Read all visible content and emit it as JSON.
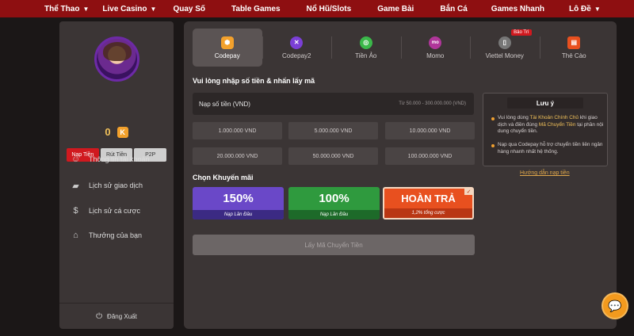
{
  "nav": {
    "items": [
      {
        "label": "Thể Thao",
        "chevron": true
      },
      {
        "label": "Live Casino",
        "chevron": true
      },
      {
        "label": "Quay Số",
        "chevron": false
      },
      {
        "label": "Table Games",
        "chevron": false
      },
      {
        "label": "Nổ Hũ/Slots",
        "chevron": false
      },
      {
        "label": "Game Bài",
        "chevron": false
      },
      {
        "label": "Bắn Cá",
        "chevron": false
      },
      {
        "label": "Games Nhanh",
        "chevron": false
      },
      {
        "label": "Lô Đề",
        "chevron": true
      }
    ]
  },
  "account": {
    "balance": "0",
    "currency": "K",
    "tabs": [
      "Nạp Tiền",
      "Rút Tiền",
      "P2P"
    ],
    "active_tab": "Nạp Tiền",
    "menu": [
      {
        "label": "Thông tin tài khoản",
        "icon": "user-icon"
      },
      {
        "label": "Lịch sử giao dịch",
        "icon": "wallet-icon"
      },
      {
        "label": "Lịch sử cá cược",
        "icon": "money-bag-icon"
      },
      {
        "label": "Thưởng của bạn",
        "icon": "gift-icon"
      }
    ],
    "logout": "Đăng Xuất"
  },
  "payment": {
    "methods": [
      {
        "label": "Codepay",
        "icon": "codepay-icon",
        "color": "#f3a12c",
        "glyph": "⬢"
      },
      {
        "label": "Codepay2",
        "icon": "codepay2-icon",
        "color": "#7b3fd6",
        "glyph": "✕"
      },
      {
        "label": "Tiền Ảo",
        "icon": "crypto-icon",
        "color": "#3bb84a",
        "glyph": "◎"
      },
      {
        "label": "Momo",
        "icon": "momo-icon",
        "color": "#b0369a",
        "glyph": "mo"
      },
      {
        "label": "Viettel Money",
        "icon": "viettel-money-icon",
        "color": "#777777",
        "glyph": "▯",
        "badge": "Bảo Trì"
      },
      {
        "label": "Thẻ Cào",
        "icon": "scratch-card-icon",
        "color": "#e8501f",
        "glyph": "▤"
      }
    ],
    "active_method": "Codepay",
    "instruction": "Vui lòng nhập số tiền & nhấn lấy mã",
    "amount_label": "Nạp số tiền (VND)",
    "amount_range": "Từ 50.000 - 300.000.000 (VND)",
    "presets": [
      "1.000.000 VND",
      "5.000.000 VND",
      "10.000.000 VND",
      "20.000.000 VND",
      "50.000.000 VND",
      "100.000.000 VND"
    ],
    "promo_heading": "Chọn Khuyến mãi",
    "promos": [
      {
        "title": "150%",
        "subtitle": "Nạp Lần Đầu"
      },
      {
        "title": "100%",
        "subtitle": "Nạp Lần Đầu"
      },
      {
        "title": "HOÀN TRẢ",
        "subtitle": "1,2% tổng cược",
        "selected": true
      }
    ],
    "submit_label": "Lấy Mã Chuyển Tiền"
  },
  "notice": {
    "title": "Lưu ý",
    "note1_a": "Vui lòng dùng ",
    "note1_b": "Tài Khoản Chính Chủ",
    "note1_c": " khi giao dịch và điền đúng ",
    "note1_d": "Mã Chuyển Tiền",
    "note1_e": " tại phần nội dung chuyển tiền.",
    "note2": "Nạp qua Codepay hỗ trợ chuyển tiền liên ngân hàng nhanh nhất hệ thống.",
    "guide_link": "Hướng dẫn nạp tiền"
  },
  "colors": {
    "nav_bg": "#8e0f11",
    "accent_red": "#d0191f",
    "highlight": "#f1c15a"
  }
}
